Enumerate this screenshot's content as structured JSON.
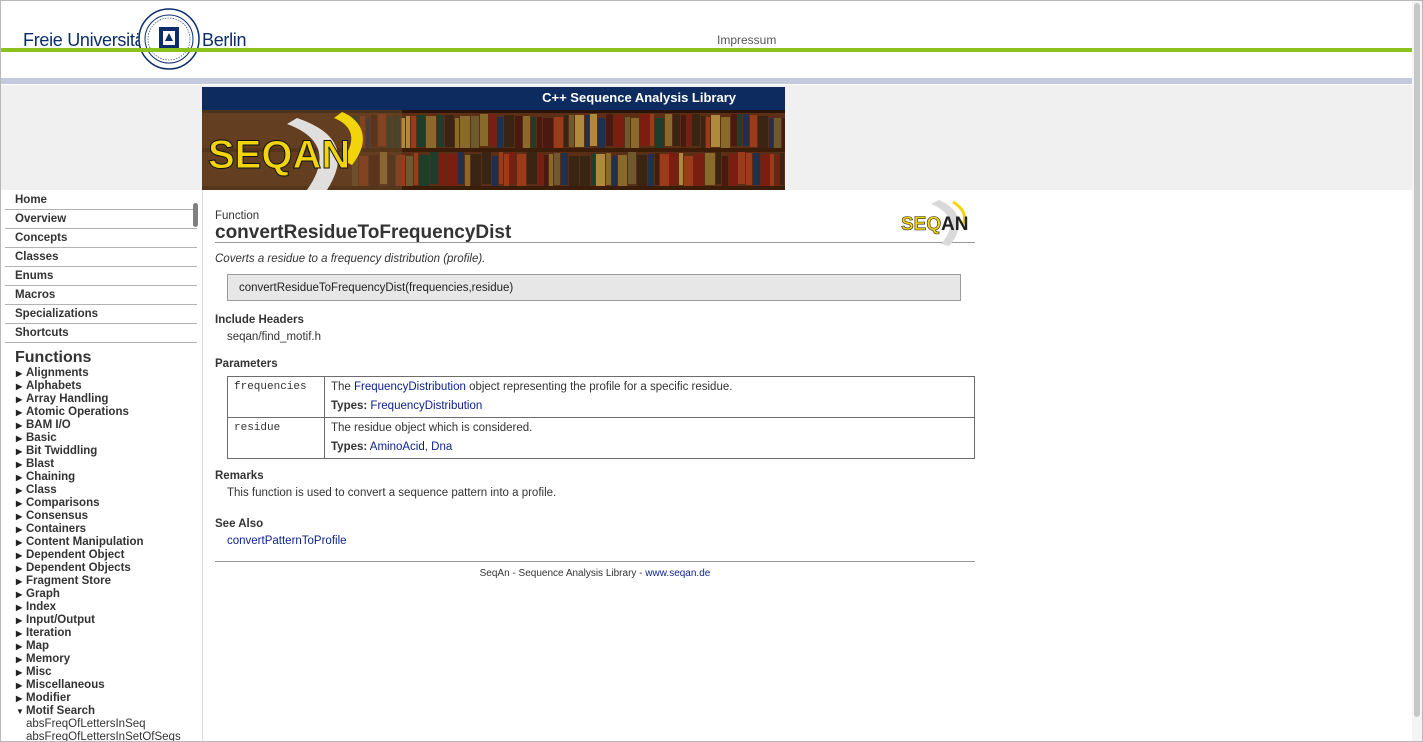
{
  "header": {
    "logo_left": "Freie Universität",
    "logo_right": "Berlin",
    "impressum": "Impressum"
  },
  "banner": {
    "title": "C++ Sequence Analysis Library",
    "logo_text": "SEQAN"
  },
  "nav": {
    "items": [
      "Home",
      "Overview",
      "Concepts",
      "Classes",
      "Enums",
      "Macros",
      "Specializations",
      "Shortcuts"
    ],
    "functions_heading": "Functions",
    "function_groups": [
      "Alignments",
      "Alphabets",
      "Array Handling",
      "Atomic Operations",
      "BAM I/O",
      "Basic",
      "Bit Twiddling",
      "Blast",
      "Chaining",
      "Class",
      "Comparisons",
      "Consensus",
      "Containers",
      "Content Manipulation",
      "Dependent Object",
      "Dependent Objects",
      "Fragment Store",
      "Graph",
      "Index",
      "Input/Output",
      "Iteration",
      "Map",
      "Memory",
      "Misc",
      "Miscellaneous",
      "Modifier"
    ],
    "expanded_group": "Motif Search",
    "expanded_items": [
      "absFreqOfLettersInSeq",
      "absFreqOfLettersInSetOfSeqs"
    ]
  },
  "content": {
    "kind": "Function",
    "title": "convertResidueToFrequencyDist",
    "description": "Coverts a residue to a frequency distribution (profile).",
    "signature": "convertResidueToFrequencyDist(frequencies,residue)",
    "include_heading": "Include Headers",
    "include_file": "seqan/find_motif.h",
    "params_heading": "Parameters",
    "params": [
      {
        "name": "frequencies",
        "desc_pre": "The ",
        "desc_link": "FrequencyDistribution",
        "desc_post": " object representing the profile for a specific residue.",
        "types_label": "Types:",
        "types": [
          "FrequencyDistribution"
        ]
      },
      {
        "name": "residue",
        "desc_pre": "The residue object which is considered.",
        "desc_link": "",
        "desc_post": "",
        "types_label": "Types:",
        "types": [
          "AminoAcid",
          "Dna"
        ],
        "types_sep": ", "
      }
    ],
    "remarks_heading": "Remarks",
    "remarks_text": "This function is used to convert a sequence pattern into a profile.",
    "see_also_heading": "See Also",
    "see_also_link": "convertPatternToProfile",
    "footer_text": "SeqAn - Sequence Analysis Library - ",
    "footer_link": "www.seqan.de"
  },
  "colors": {
    "fu_green": "#8cc21d",
    "banner_navy": "#0d2b5f",
    "link_blue": "#0b1f8c",
    "seqan_yellow": "#f2d40a"
  }
}
